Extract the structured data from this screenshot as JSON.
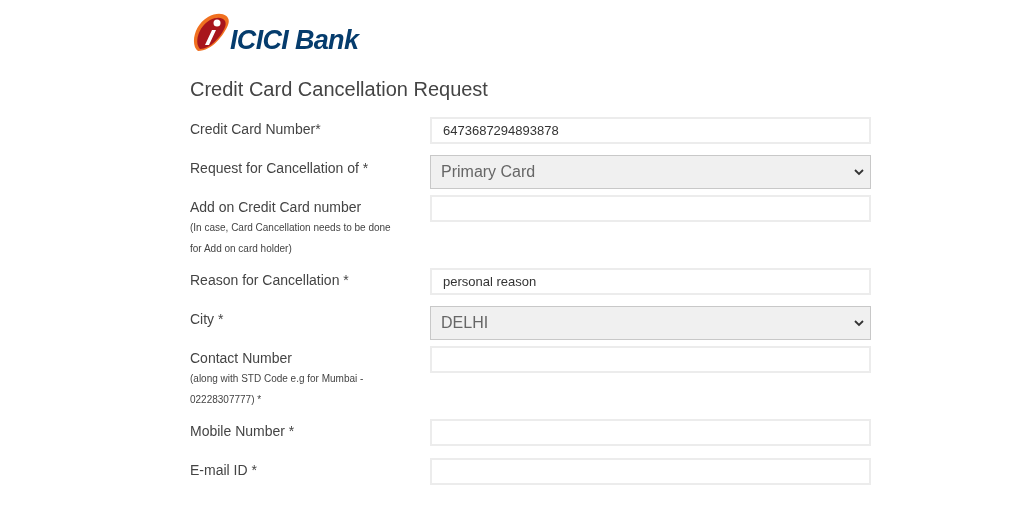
{
  "logo": {
    "text": "ICICI Bank"
  },
  "title": "Credit Card Cancellation Request",
  "fields": [
    {
      "kind": "text",
      "label": "Credit Card Number*",
      "value": "6473687294893878"
    },
    {
      "kind": "select",
      "label": "Request for Cancellation of *",
      "value": "Primary Card"
    },
    {
      "kind": "text",
      "label": "Add on Credit Card number",
      "notes": [
        "(In case, Card Cancellation needs to be done",
        "for Add on card holder)"
      ]
    },
    {
      "kind": "text",
      "label": "Reason for Cancellation *",
      "value": "personal reason"
    },
    {
      "kind": "select",
      "label": "City *",
      "value": "DELHI"
    },
    {
      "kind": "text",
      "label": "Contact Number",
      "notes": [
        "(along with STD Code e.g for Mumbai -",
        "02228307777) *"
      ]
    },
    {
      "kind": "text",
      "label": "Mobile Number *"
    },
    {
      "kind": "text",
      "label": "E-mail ID *"
    }
  ]
}
